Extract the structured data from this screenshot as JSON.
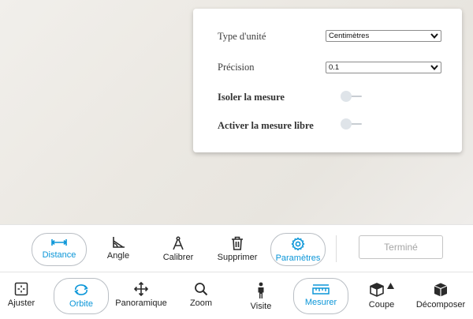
{
  "settings_panel": {
    "unit_type_label": "Type d'unité",
    "unit_type_value": "Centimètres",
    "precision_label": "Précision",
    "precision_value": "0.1",
    "isolate_label": "Isoler la mesure",
    "free_measure_label": "Activer la mesure libre"
  },
  "measure_toolbar": {
    "distance": "Distance",
    "angle": "Angle",
    "calibrate": "Calibrer",
    "delete": "Supprimer",
    "settings": "Paramètres",
    "done": "Terminé"
  },
  "main_toolbar": {
    "fit": "Ajuster",
    "orbit": "Orbite",
    "pan": "Panoramique",
    "zoom": "Zoom",
    "walk": "Visite",
    "measure": "Mesurer",
    "section": "Coupe",
    "explode": "Décomposer"
  },
  "colors": {
    "accent": "#0b96d8",
    "icon": "#2b2b2b",
    "disabled_text": "#a5a5a5"
  }
}
